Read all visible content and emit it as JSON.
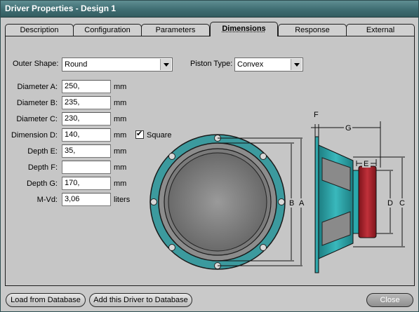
{
  "window": {
    "title": "Driver Properties - Design 1"
  },
  "tabs": [
    {
      "label": "Description"
    },
    {
      "label": "Configuration"
    },
    {
      "label": "Parameters"
    },
    {
      "label": "Dimensions"
    },
    {
      "label": "Response"
    },
    {
      "label": "External"
    }
  ],
  "form": {
    "outer_shape_label": "Outer Shape:",
    "outer_shape_value": "Round",
    "piston_type_label": "Piston Type:",
    "piston_type_value": "Convex",
    "fields": [
      {
        "label": "Diameter A:",
        "value": "250,",
        "unit": "mm"
      },
      {
        "label": "Diameter B:",
        "value": "235,",
        "unit": "mm"
      },
      {
        "label": "Diameter C:",
        "value": "230,",
        "unit": "mm"
      },
      {
        "label": "Dimension D:",
        "value": "140,",
        "unit": "mm"
      },
      {
        "label": "Depth E:",
        "value": "35,",
        "unit": "mm"
      },
      {
        "label": "Depth F:",
        "value": "",
        "unit": "mm"
      },
      {
        "label": "Depth G:",
        "value": "170,",
        "unit": "mm"
      },
      {
        "label": "M-Vd:",
        "value": "3,06",
        "unit": "liters"
      }
    ],
    "square_label": "Square",
    "square_checked": true
  },
  "diagram": {
    "labels": {
      "a": "A",
      "b": "B",
      "c": "C",
      "d": "D",
      "e": "E",
      "f": "F",
      "g": "G"
    },
    "colors": {
      "frame": "#2aa8ac",
      "magnet": "#b0202a",
      "cone": "#8a8a8a",
      "surround": "#6e6e6e"
    }
  },
  "buttons": {
    "load": "Load from Database",
    "add": "Add this Driver to Database",
    "close": "Close"
  }
}
